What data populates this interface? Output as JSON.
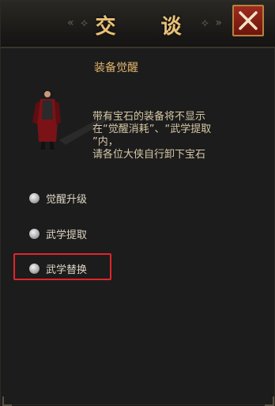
{
  "dialog": {
    "title": "交 谈",
    "ornament_left": "«  ⟡",
    "ornament_right": "⟡  »",
    "close_icon": "close-x-icon",
    "subtitle": "装备觉醒",
    "description": "带有宝石的装备将不显示\n在“觉醒消耗”、“武学提取\n”内，\n请各位大侠自行卸下宝石",
    "options": [
      {
        "label": "觉醒升级"
      },
      {
        "label": "武学提取"
      },
      {
        "label": "武学替换"
      }
    ]
  },
  "colors": {
    "title": "#e7c27a",
    "highlight": "#e0262a",
    "close_bg": "#8a2217"
  }
}
